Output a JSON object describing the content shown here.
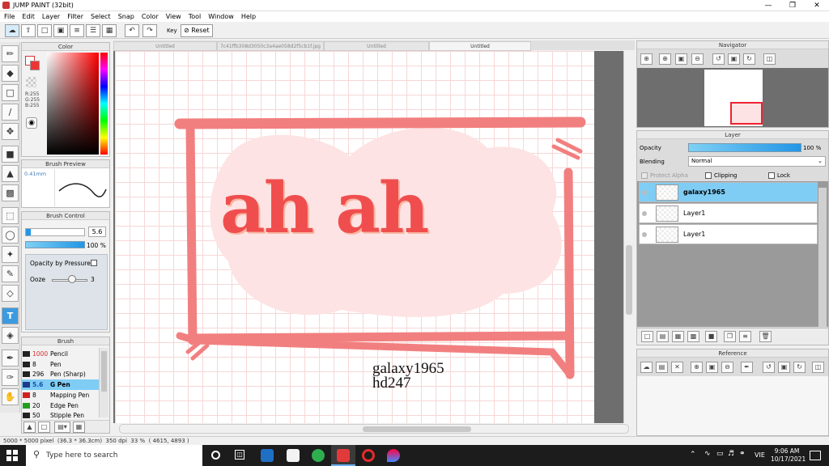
{
  "window": {
    "title": "JUMP PAINT (32bit)"
  },
  "menu": [
    "File",
    "Edit",
    "Layer",
    "Filter",
    "Select",
    "Snap",
    "Color",
    "View",
    "Tool",
    "Window",
    "Help"
  ],
  "toolbar": {
    "key_label": "Key",
    "reset_label": "Reset"
  },
  "tabs": [
    "Untitled",
    "7c41ffb308d3050c3a4ae058d2f5cb1f.jpg",
    "Untitled",
    "Untitled"
  ],
  "color_panel": {
    "title": "Color",
    "r": "R:255",
    "g": "G:255",
    "b": "B:255"
  },
  "brush_preview": {
    "title": "Brush Preview",
    "size": "0.41mm"
  },
  "brush_control": {
    "title": "Brush Control",
    "size_value": "5.6",
    "opacity_value": "100 %",
    "opacity_fraction": 1.0,
    "opacity_by_pressure_label": "Opacity by Pressure",
    "ooze_label": "Ooze",
    "ooze_value": "3"
  },
  "brush_list": {
    "title": "Brush",
    "items": [
      {
        "size": "1000",
        "name": "Pencil",
        "color": "#222222",
        "size_color": "#d03030",
        "selected": false
      },
      {
        "size": "8",
        "name": "Pen",
        "color": "#222222",
        "size_color": "#000000",
        "selected": false
      },
      {
        "size": "296",
        "name": "Pen (Sharp)",
        "color": "#222222",
        "size_color": "#000000",
        "selected": false
      },
      {
        "size": "5.6",
        "name": "G Pen",
        "color": "#1e3b8a",
        "size_color": "#1a4fb0",
        "selected": true
      },
      {
        "size": "8",
        "name": "Mapping Pen",
        "color": "#d02020",
        "size_color": "#000000",
        "selected": false
      },
      {
        "size": "20",
        "name": "Edge Pen",
        "color": "#20a020",
        "size_color": "#000000",
        "selected": false
      },
      {
        "size": "50",
        "name": "Stipple Pen",
        "color": "#222222",
        "size_color": "#000000",
        "selected": false
      }
    ]
  },
  "canvas": {
    "artwork_text": "ah ah",
    "caption_line1": "galaxy1965",
    "caption_line2": "hd247"
  },
  "navigator": {
    "title": "Navigator"
  },
  "layer_panel": {
    "title": "Layer",
    "opacity_label": "Opacity",
    "opacity_value": "100 %",
    "opacity_fraction": 1.0,
    "blending_label": "Blending",
    "blending_value": "Normal",
    "protect_alpha_label": "Protect Alpha",
    "clipping_label": "Clipping",
    "lock_label": "Lock",
    "layers": [
      {
        "name": "galaxy1965",
        "selected": true
      },
      {
        "name": "Layer1",
        "selected": false
      },
      {
        "name": "Layer1",
        "selected": false
      }
    ]
  },
  "reference": {
    "title": "Reference"
  },
  "status": {
    "text": "5000 * 5000 pixel  (36.3 * 36.3cm)  350 dpi  33 %  ( 4615, 4893 )"
  },
  "taskbar": {
    "search_placeholder": "Type here to search",
    "lang": "VIE",
    "time": "9:06 AM",
    "date": "10/17/2021"
  },
  "colors": {
    "accent": "#2296e6",
    "selected_row": "#7fcdf5",
    "artwork": "#f07a7a",
    "taskbar": "#1c1c1c"
  }
}
